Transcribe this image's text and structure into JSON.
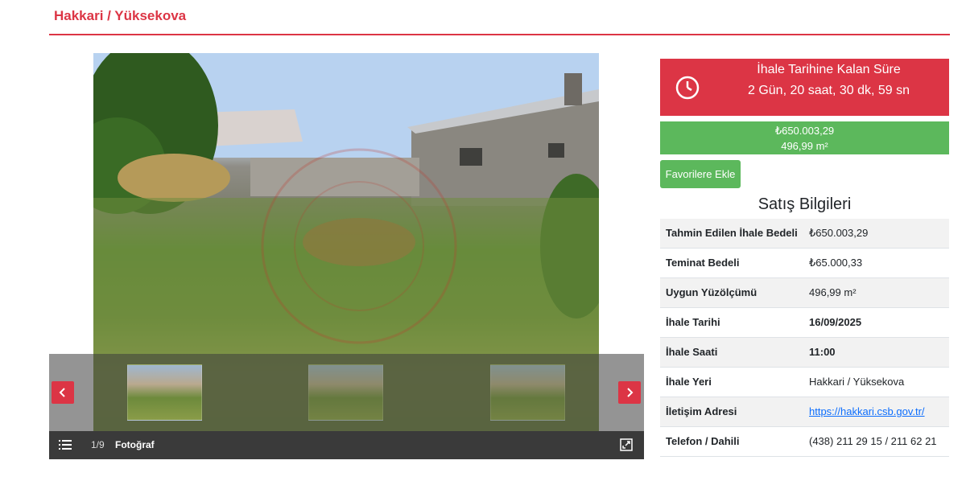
{
  "breadcrumb": "Hakkari / Yüksekova",
  "gallery": {
    "counter": "1/9",
    "label": "Fotoğraf",
    "prev_icon": "chevron-left-icon",
    "next_icon": "chevron-right-icon",
    "menu_icon": "list-icon",
    "expand_icon": "expand-icon"
  },
  "countdown": {
    "title": "İhale Tarihine Kalan Süre",
    "time": "2 Gün, 20 saat, 30 dk, 59 sn",
    "icon": "clock-icon"
  },
  "price": {
    "amount": "₺650.003,29",
    "area": "496,99 m²"
  },
  "favorite_label": "Favorilere Ekle",
  "section_title": "Satış Bilgileri",
  "info": {
    "estimate_label": "Tahmin Edilen İhale Bedeli",
    "estimate_value": "₺650.003,29",
    "deposit_label": "Teminat Bedeli",
    "deposit_value": "₺65.000,33",
    "area_label": "Uygun Yüzölçümü",
    "area_value": "496,99 m²",
    "date_label": "İhale Tarihi",
    "date_value": "16/09/2025",
    "time_label": "İhale Saati",
    "time_value": "11:00",
    "place_label": "İhale Yeri",
    "place_value": "Hakkari / Yüksekova",
    "contact_label": "İletişim Adresi",
    "contact_value": "https://hakkari.csb.gov.tr/",
    "phone_label": "Telefon / Dahili",
    "phone_value": "(438) 211 29 15 / 211 62 21"
  },
  "colors": {
    "accent_red": "#dc3545",
    "green": "#5cb85c",
    "link": "#0d6efd"
  }
}
